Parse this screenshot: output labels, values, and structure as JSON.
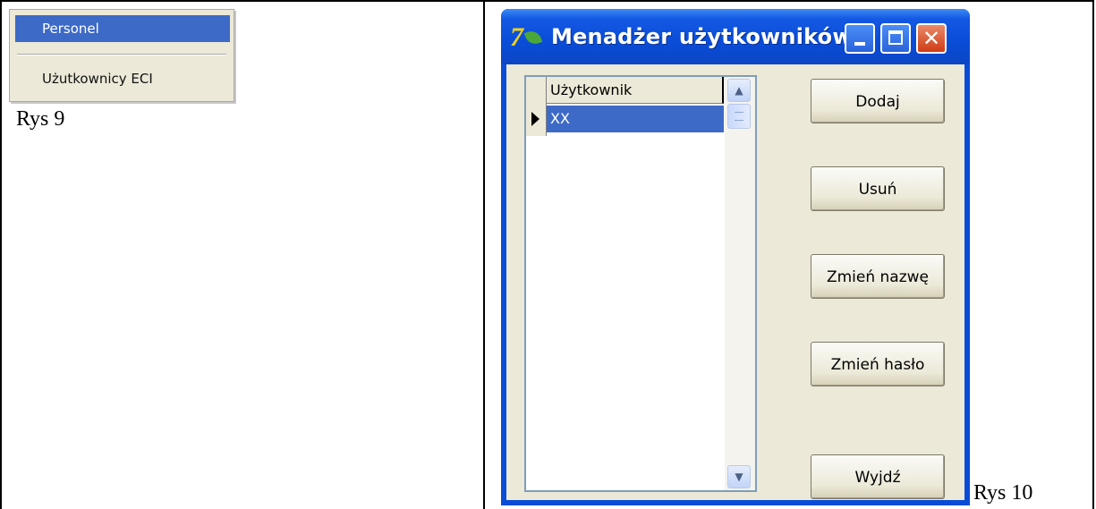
{
  "figure9": {
    "menu_items": [
      "Personel",
      "Użutkownicy ECI"
    ],
    "caption": "Rys 9"
  },
  "figure10": {
    "window_title": "Menadżer użytkowników",
    "grid": {
      "column_header": "Użytkownik",
      "rows": [
        "XX"
      ]
    },
    "buttons": {
      "add": "Dodaj",
      "remove": "Usuń",
      "rename": "Zmień nazwę",
      "change_password": "Zmień hasło",
      "exit": "Wyjdź"
    },
    "caption": "Rys 10"
  },
  "colors": {
    "selection": "#3d6ac6",
    "titlebar": "#0a4cd8",
    "dialog_face": "#ece9d8",
    "close_button": "#cf3b15"
  },
  "icons": [
    "app-logo-icon",
    "minimize-icon",
    "maximize-icon",
    "close-icon",
    "scroll-up-icon",
    "scroll-down-icon",
    "row-pointer-icon"
  ]
}
